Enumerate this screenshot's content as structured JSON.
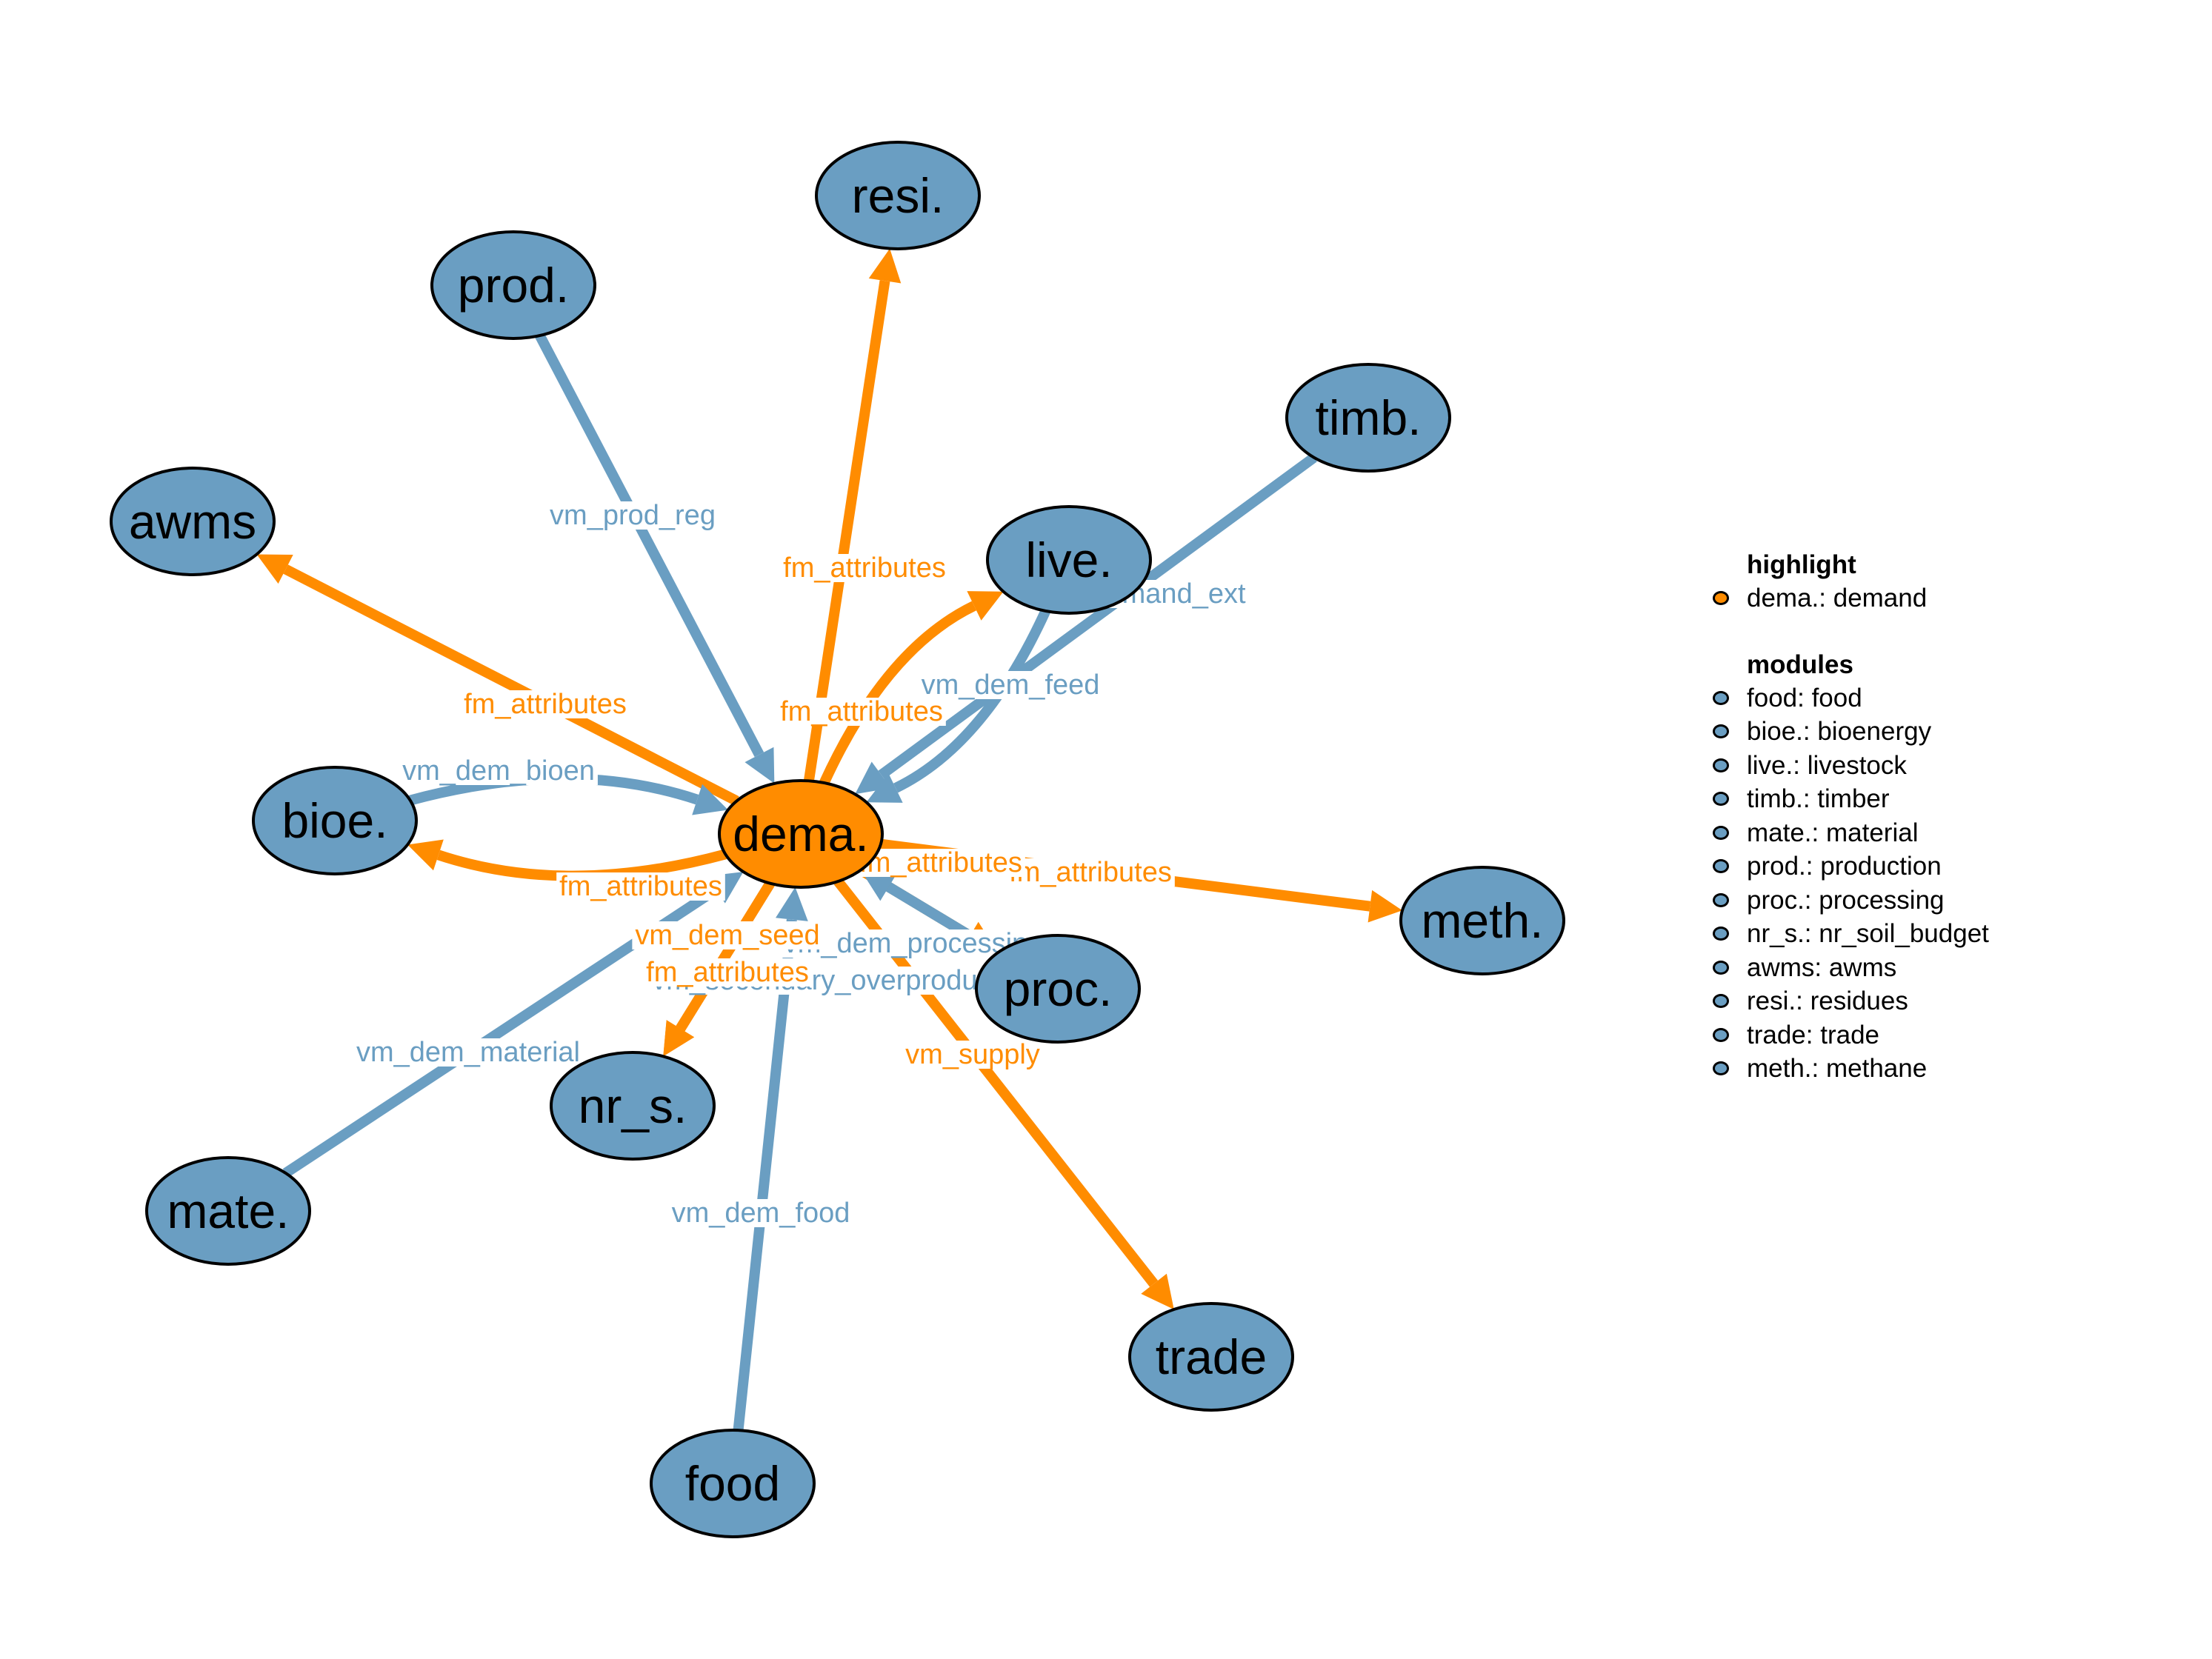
{
  "colors": {
    "highlight": "#FF8C00",
    "module": "#6A9EC2",
    "outline": "#000000",
    "background": "#FFFFFF"
  },
  "nodes": [
    {
      "id": "dema",
      "label": "dema.",
      "group": "highlight"
    },
    {
      "id": "resi",
      "label": "resi.",
      "group": "module"
    },
    {
      "id": "prod",
      "label": "prod.",
      "group": "module"
    },
    {
      "id": "timb",
      "label": "timb.",
      "group": "module"
    },
    {
      "id": "awms",
      "label": "awms",
      "group": "module"
    },
    {
      "id": "live",
      "label": "live.",
      "group": "module"
    },
    {
      "id": "bioe",
      "label": "bioe.",
      "group": "module"
    },
    {
      "id": "meth",
      "label": "meth.",
      "group": "module"
    },
    {
      "id": "proc",
      "label": "proc.",
      "group": "module"
    },
    {
      "id": "nr_s",
      "label": "nr_s.",
      "group": "module"
    },
    {
      "id": "mate",
      "label": "mate.",
      "group": "module"
    },
    {
      "id": "trade",
      "label": "trade",
      "group": "module"
    },
    {
      "id": "food",
      "label": "food",
      "group": "module"
    }
  ],
  "edges": [
    {
      "from": "dema",
      "to": "resi",
      "label": "fm_attributes",
      "group": "highlight"
    },
    {
      "from": "prod",
      "to": "dema",
      "label": "vm_prod_reg",
      "group": "module"
    },
    {
      "from": "dema",
      "to": "awms",
      "label": "fm_attributes",
      "group": "highlight"
    },
    {
      "from": "dema",
      "to": "live",
      "label": "fm_attributes",
      "group": "highlight"
    },
    {
      "from": "live",
      "to": "dema",
      "label": "vm_dem_feed",
      "group": "module"
    },
    {
      "from": "timb",
      "to": "dema",
      "label": "pm_demand_ext",
      "group": "module"
    },
    {
      "from": "bioe",
      "to": "dema",
      "label": "vm_dem_bioen",
      "group": "module"
    },
    {
      "from": "dema",
      "to": "bioe",
      "label": "fm_attributes",
      "group": "highlight"
    },
    {
      "from": "dema",
      "to": "meth",
      "label": "fm_attributes",
      "group": "highlight"
    },
    {
      "from": "dema",
      "to": "proc",
      "label": "fm_attributes",
      "group": "highlight"
    },
    {
      "from": "proc",
      "to": "dema",
      "label": "vm_dem_processing",
      "group": "module"
    },
    {
      "from": "proc",
      "to": "dema",
      "label": "vm_secondary_overproduction",
      "group": "module"
    },
    {
      "from": "dema",
      "to": "nr_s",
      "label": "vm_dem_seed",
      "group": "highlight"
    },
    {
      "from": "dema",
      "to": "nr_s",
      "label": "fm_attributes",
      "group": "highlight"
    },
    {
      "from": "mate",
      "to": "dema",
      "label": "vm_dem_material",
      "group": "module"
    },
    {
      "from": "dema",
      "to": "trade",
      "label": "vm_supply",
      "group": "highlight"
    },
    {
      "from": "food",
      "to": "dema",
      "label": "vm_dem_food",
      "group": "module"
    }
  ],
  "legend": {
    "highlight_title": "highlight",
    "highlight_items": [
      {
        "text": "dema.: demand"
      }
    ],
    "modules_title": "modules",
    "module_items": [
      {
        "text": "food: food"
      },
      {
        "text": "bioe.: bioenergy"
      },
      {
        "text": "live.: livestock"
      },
      {
        "text": "timb.: timber"
      },
      {
        "text": "mate.: material"
      },
      {
        "text": "prod.: production"
      },
      {
        "text": "proc.: processing"
      },
      {
        "text": "nr_s.: nr_soil_budget"
      },
      {
        "text": "awms: awms"
      },
      {
        "text": "resi.: residues"
      },
      {
        "text": "trade: trade"
      },
      {
        "text": "meth.: methane"
      }
    ]
  }
}
